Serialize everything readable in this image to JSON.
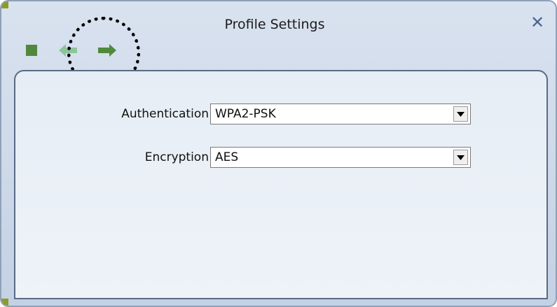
{
  "dialog": {
    "title": "Profile Settings",
    "close_icon": "close-icon"
  },
  "toolbar": {
    "stop_icon": "stop-icon",
    "back_icon": "arrow-left-icon",
    "next_icon": "arrow-right-icon",
    "accent_color": "#4f8a3c",
    "disabled_color": "#8fc49a"
  },
  "form": {
    "authentication": {
      "label": "Authentication",
      "value": "WPA2-PSK"
    },
    "encryption": {
      "label": "Encryption",
      "value": "AES"
    }
  }
}
